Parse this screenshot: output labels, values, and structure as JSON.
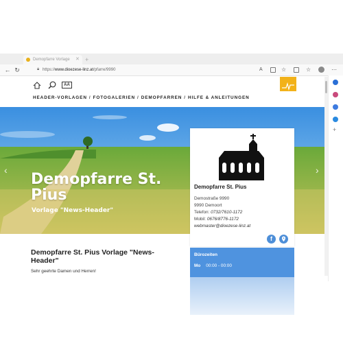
{
  "browser": {
    "tab_title": "Demopfarre Vorlage",
    "url_prefix": "https://",
    "url_host": "www.dioezese-linz.at",
    "url_path": "/pfarre/9990",
    "icons": [
      "back-icon",
      "reload-icon",
      "lock-icon",
      "read-aloud-icon",
      "favorites-icon",
      "collections-icon",
      "profile-icon",
      "more-icon"
    ]
  },
  "site": {
    "nav": {
      "items": [
        "HEADER-VORLAGEN",
        "FOTOGALERIEN",
        "DEMOPFARREN",
        "HILFE & ANLEITUNGEN"
      ],
      "separator": "/"
    },
    "util": {
      "font_size_label": "AA"
    }
  },
  "hero": {
    "title_line1": "Demopfarre St.",
    "title_line2": "Pius",
    "subtitle": "Vorlage \"News-Header\""
  },
  "card": {
    "name": "Demopfarre St. Pius",
    "street": "Demostraße 9990",
    "city": "9990 Demoort",
    "phone_label": "Telefon:",
    "phone": "0732/7610-1172",
    "mobile_label": "Mobil:",
    "mobile": "0676/8776-1172",
    "email": "webmaster@dioezese-linz.at",
    "social": {
      "facebook": "f"
    }
  },
  "hours": {
    "title": "Bürozeiten",
    "day": "Mo",
    "time": "00:00 - 00:00"
  },
  "article": {
    "title": "Demopfarre St. Pius Vorlage \"News-Header\"",
    "greeting": "Sehr geehrte Damen und Herren!"
  },
  "colors": {
    "accent_blue": "#4f93df",
    "logo_yellow": "#f2b21a"
  }
}
